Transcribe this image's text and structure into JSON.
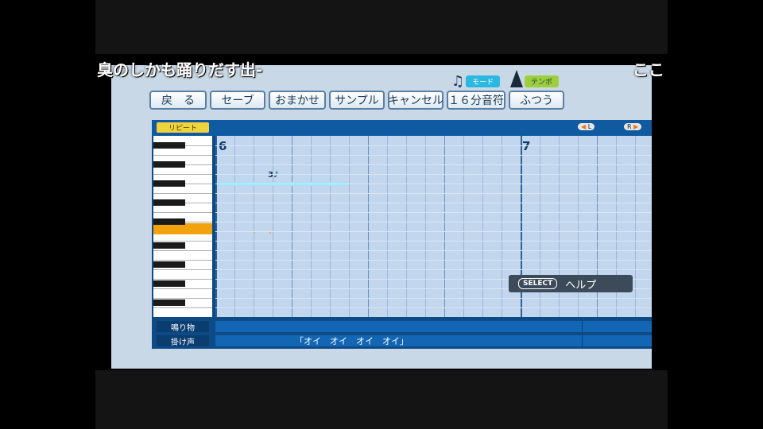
{
  "comments": {
    "left": "臭のしかも踊りだす出-",
    "right": "ここ"
  },
  "toolbar": {
    "buttons": [
      "戻　る",
      "セーブ",
      "おまかせ",
      "サンプル",
      "キャンセル",
      "１６分音符",
      "ふつう"
    ]
  },
  "mode": {
    "label": "モード",
    "icon": "music-note-icon"
  },
  "tempo": {
    "label": "テンポ",
    "icon": "metronome-icon"
  },
  "editor": {
    "repeat_label": "リピート",
    "scroll_left": "L",
    "scroll_right": "R",
    "measures": [
      "6",
      "7"
    ],
    "note_mark": "3♪",
    "dots": "・・"
  },
  "help": {
    "button": "SELECT",
    "label": "ヘルプ"
  },
  "lower": {
    "row1_label": "鳴り物",
    "row2_label": "掛け声",
    "chant": "「オイ　オイ　オイ　オイ」"
  },
  "colors": {
    "accent": "#0d4a86",
    "highlight_key": "#f2a20c",
    "repeat_tag": "#f0d23c",
    "sustain": "#9fe4f8"
  }
}
